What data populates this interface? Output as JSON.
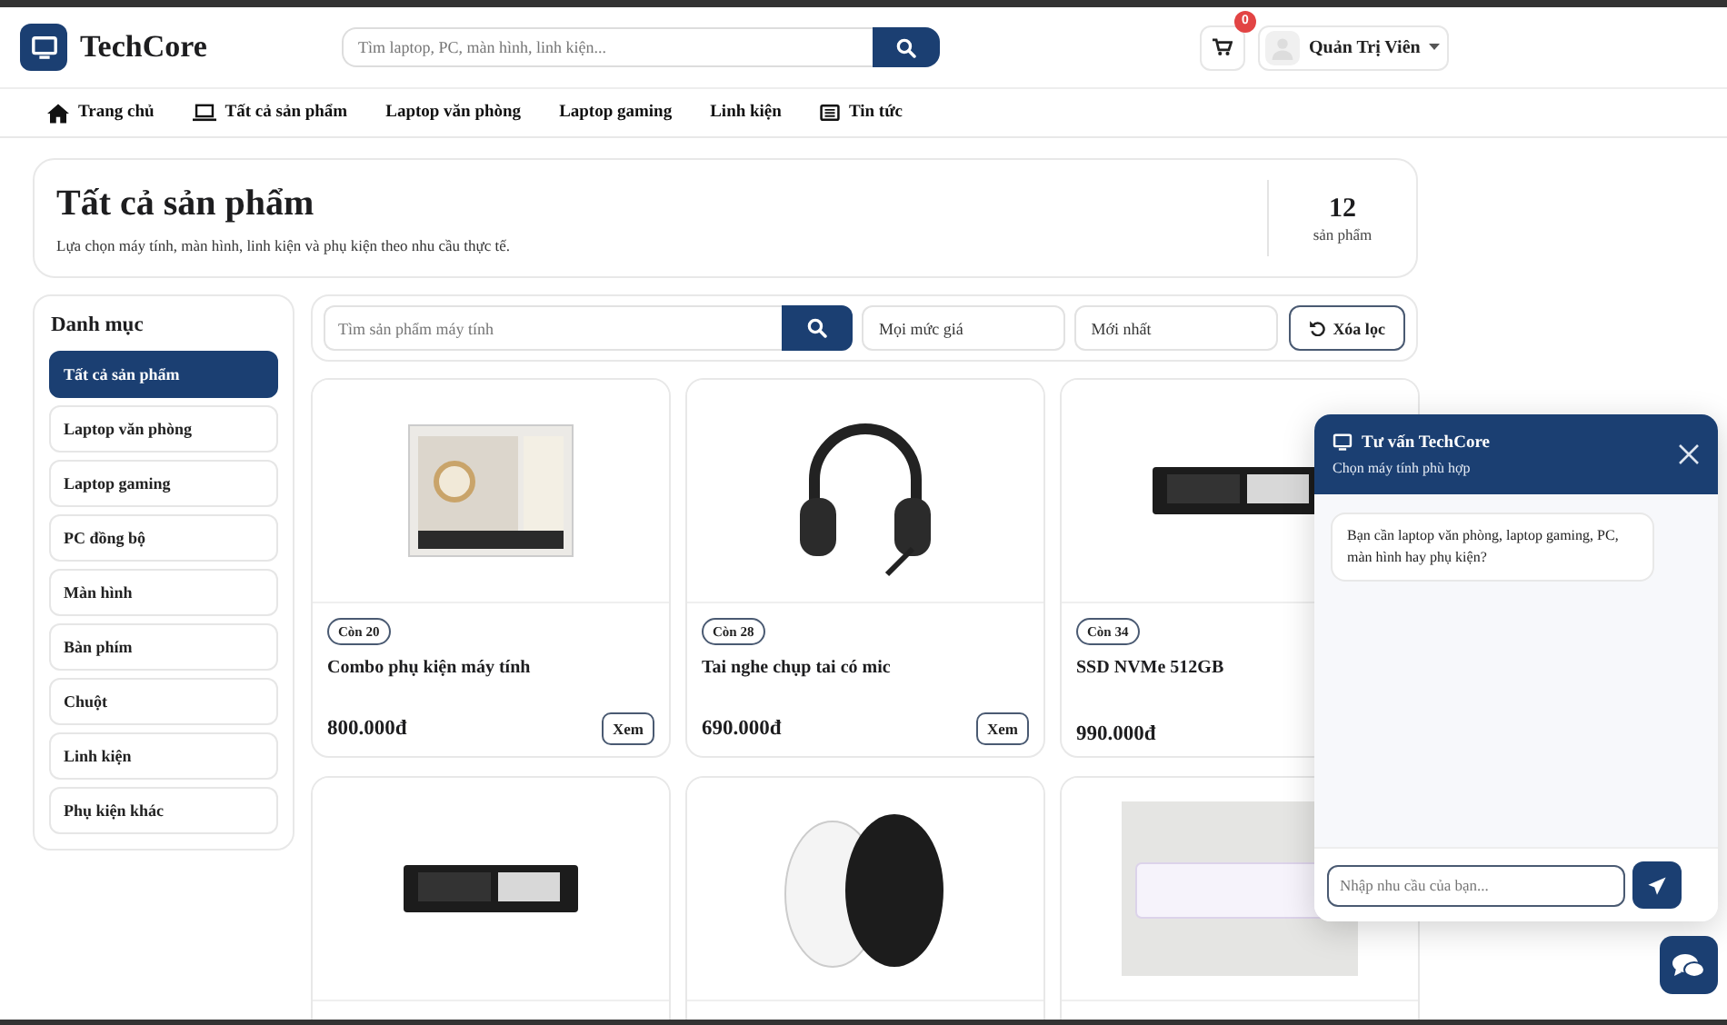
{
  "header": {
    "brand": "TechCore",
    "search": {
      "placeholder": "Tìm laptop, PC, màn hình, linh kiện..."
    },
    "cart_count": "0",
    "user": "Quản Trị Viên"
  },
  "nav": [
    {
      "label": "Trang chủ"
    },
    {
      "label": "Tất cả sản phẩm"
    },
    {
      "label": "Laptop văn phòng"
    },
    {
      "label": "Laptop gaming"
    },
    {
      "label": "Linh kiện"
    },
    {
      "label": "Tin tức"
    }
  ],
  "hero": {
    "title": "Tất cả sản phẩm",
    "subtitle": "Lựa chọn máy tính, màn hình, linh kiện và phụ kiện theo nhu cầu thực tế.",
    "count": "12",
    "count_label": "sản phẩm"
  },
  "sidebar": {
    "title": "Danh mục",
    "items": [
      {
        "label": "Tất cả sản phẩm",
        "selected": true
      },
      {
        "label": "Laptop văn phòng",
        "selected": false
      },
      {
        "label": "Laptop gaming",
        "selected": false
      },
      {
        "label": "PC đồng bộ",
        "selected": false
      },
      {
        "label": "Màn hình",
        "selected": false
      },
      {
        "label": "Bàn phím",
        "selected": false
      },
      {
        "label": "Chuột",
        "selected": false
      },
      {
        "label": "Linh kiện",
        "selected": false
      },
      {
        "label": "Phụ kiện khác",
        "selected": false
      }
    ]
  },
  "filters": {
    "search": {
      "placeholder": "Tìm sản phẩm máy tính"
    },
    "price": "Mọi mức giá",
    "sort": "Mới nhất",
    "reset": "Xóa lọc"
  },
  "products": [
    {
      "stock": "Còn 20",
      "name": "Combo phụ kiện máy tính",
      "price": "800.000đ",
      "action": "Xem"
    },
    {
      "stock": "Còn 28",
      "name": "Tai nghe chụp tai có mic",
      "price": "690.000đ",
      "action": "Xem"
    },
    {
      "stock": "Còn 34",
      "name": "SSD NVMe 512GB",
      "price": "990.000đ"
    }
  ],
  "chat": {
    "title": "Tư vấn TechCore",
    "subtitle": "Chọn máy tính phù hợp",
    "messages": [
      {
        "text": "Bạn cần laptop văn phòng, laptop gaming, PC, màn hình hay phụ kiện?"
      }
    ],
    "input": {
      "placeholder": "Nhập nhu cầu của bạn..."
    }
  }
}
